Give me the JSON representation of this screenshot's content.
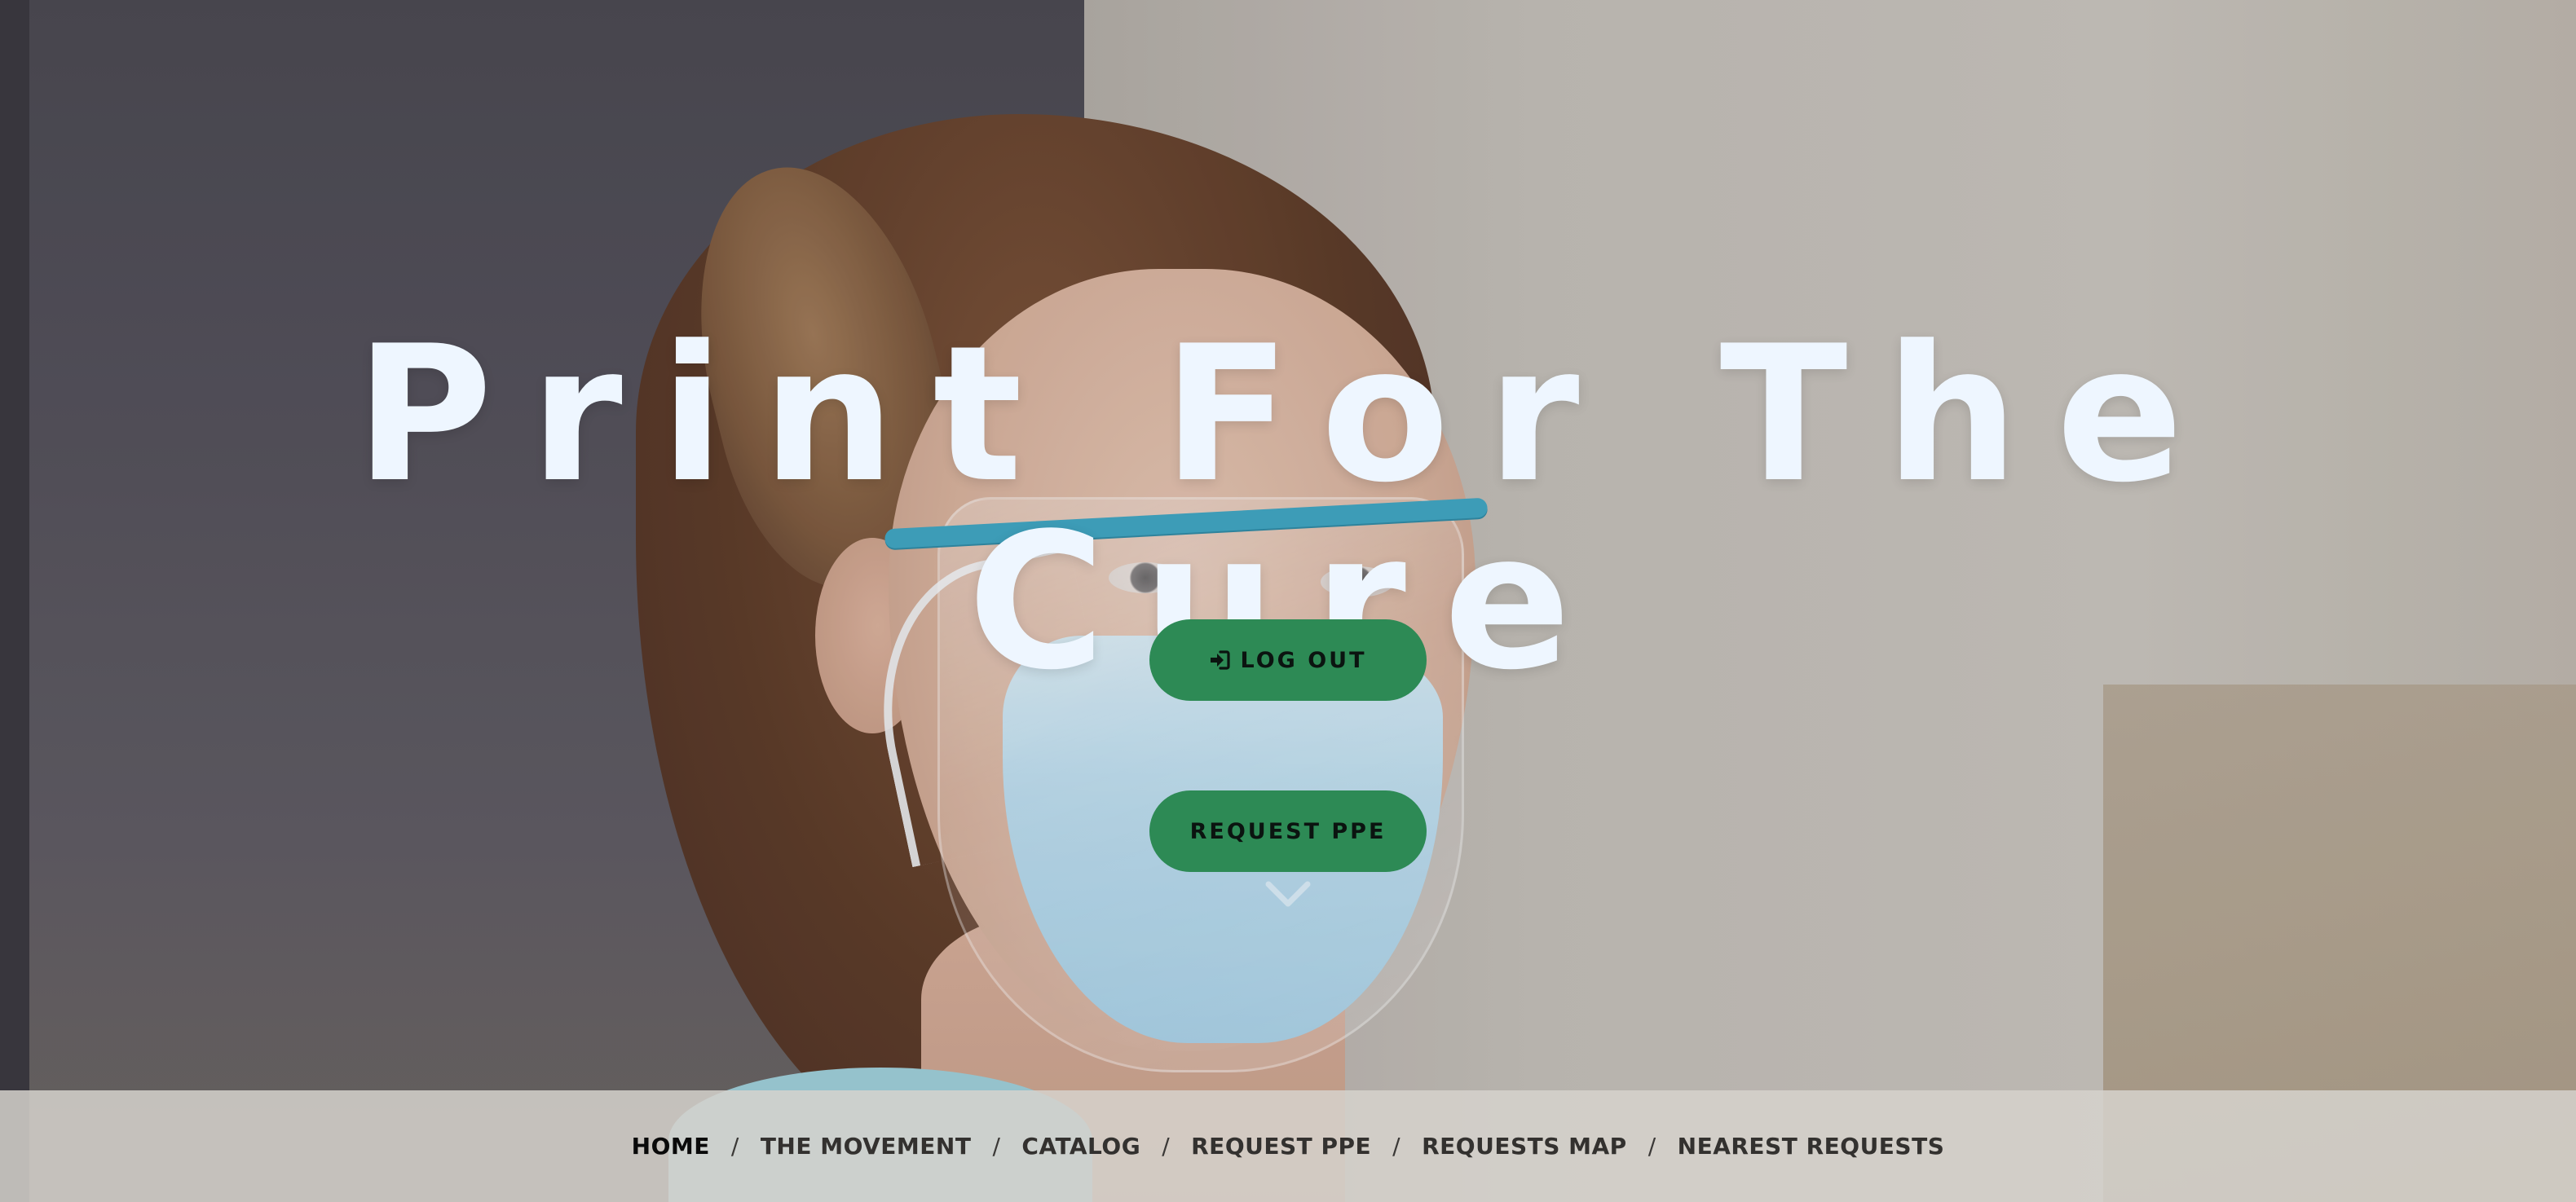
{
  "hero": {
    "title": "Print For The Cure",
    "buttons": {
      "logout_label": "LOG OUT",
      "logout_icon": "sign-in-icon",
      "request_label": "REQUEST PPE"
    },
    "scroll_icon": "chevron-down-icon"
  },
  "nav": {
    "items": [
      {
        "label": "HOME",
        "active": true
      },
      {
        "label": "THE MOVEMENT"
      },
      {
        "label": "CATALOG"
      },
      {
        "label": "REQUEST PPE"
      },
      {
        "label": "REQUESTS MAP"
      },
      {
        "label": "NEAREST REQUESTS"
      }
    ],
    "separator": "/"
  },
  "colors": {
    "button_bg": "#2d8a55",
    "title_color": "#eef6ff",
    "navbar_bg": "#d6d2cd"
  }
}
